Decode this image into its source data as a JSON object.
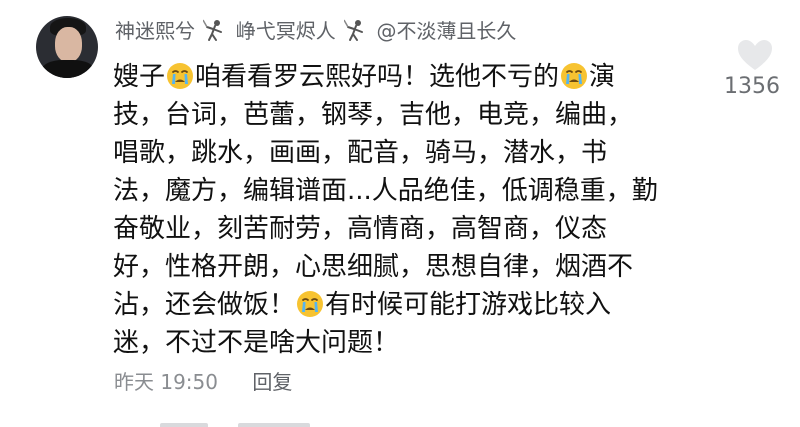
{
  "comment": {
    "username": "神迷熙兮",
    "username2": "峥弋冥烬人",
    "mention": "@不淡薄且长久",
    "lines": [
      [
        {
          "t": "嫂子"
        },
        {
          "emoji": "crying-face-icon"
        },
        {
          "t": "咱看看罗云熙好吗！选他不亏的"
        },
        {
          "emoji": "crying-face-icon"
        },
        {
          "t": "演"
        }
      ],
      [
        {
          "t": "技，台词，芭蕾，钢琴，吉他，电竞，编曲，"
        }
      ],
      [
        {
          "t": "唱歌，跳水，画画，配音，骑马，潜水，书"
        }
      ],
      [
        {
          "t": "法，魔方，编辑谱面...人品绝佳，低调稳重，勤"
        }
      ],
      [
        {
          "t": "奋敬业，刻苦耐劳，高情商，高智商，仪态"
        }
      ],
      [
        {
          "t": "好，性格开朗，心思细腻，思想自律，烟酒不"
        }
      ],
      [
        {
          "t": "沾，还会做饭！"
        },
        {
          "emoji": "crying-face-icon"
        },
        {
          "t": "有时候可能打游戏比较入"
        }
      ],
      [
        {
          "t": "迷，不过不是啥大问题！"
        }
      ]
    ],
    "time": "昨天 19:50",
    "reply_label": "回复",
    "like_count": "1356",
    "icons": {
      "like": "heart-outline-icon",
      "separator": "fencing-person-icon"
    }
  }
}
